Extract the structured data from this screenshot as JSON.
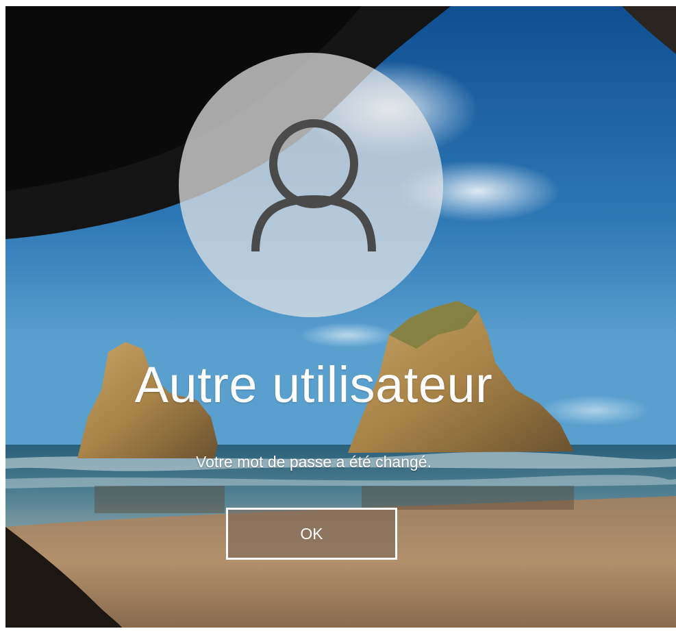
{
  "lock_screen": {
    "user_name": "Autre utilisateur",
    "message": "Votre mot de passe a été changé.",
    "ok_label": "OK",
    "avatar_icon": "user-silhouette-icon"
  },
  "colors": {
    "text": "#ffffff",
    "avatar_circle": "#e6e6e6",
    "avatar_glyph": "#4a4a4a",
    "button_border": "#ffffff"
  }
}
